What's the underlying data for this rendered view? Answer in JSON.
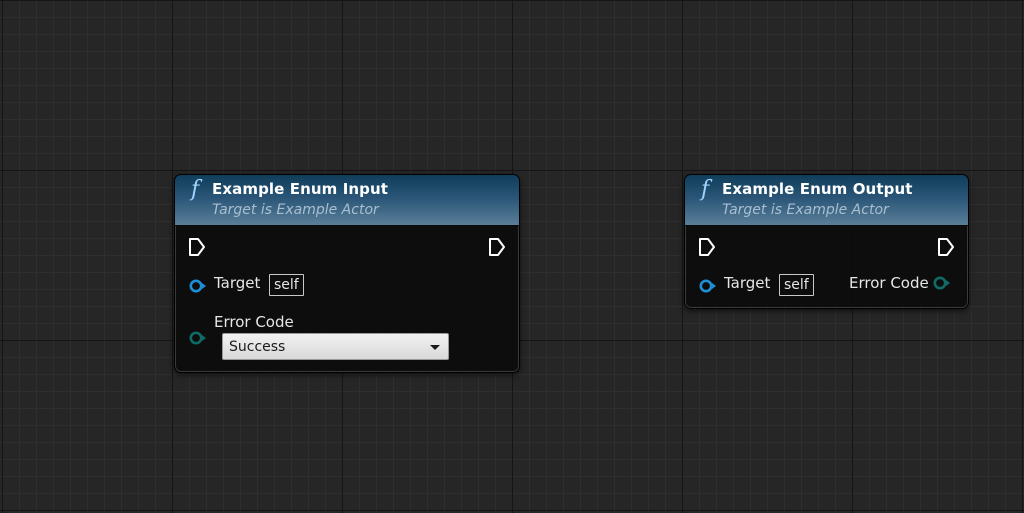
{
  "nodes": [
    {
      "id": "example-enum-input",
      "title": "Example Enum Input",
      "subtitle": "Target is Example Actor",
      "icon": "function-icon",
      "pins": {
        "target_label": "Target",
        "target_default": "self",
        "error_code_label": "Error Code",
        "error_code_value": "Success"
      }
    },
    {
      "id": "example-enum-output",
      "title": "Example Enum Output",
      "subtitle": "Target is Example Actor",
      "icon": "function-icon",
      "pins": {
        "target_label": "Target",
        "target_default": "self",
        "error_code_label": "Error Code"
      }
    }
  ],
  "colors": {
    "graph_background": "#262626",
    "header_blue": "#2a5577",
    "object_pin": "#1e8fd6",
    "enum_pin": "#0e6b66",
    "exec_pin": "#ffffff"
  },
  "icon_func_glyph": "f"
}
